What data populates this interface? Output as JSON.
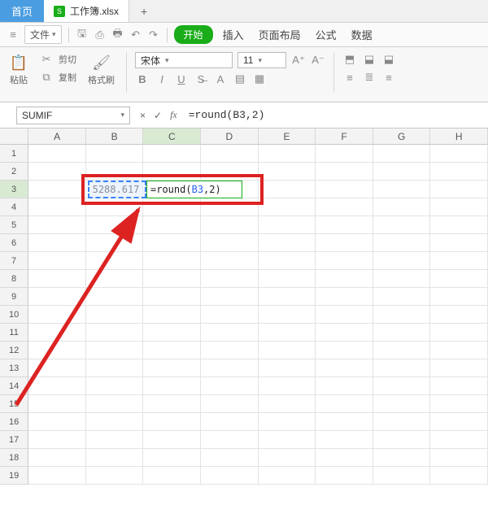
{
  "tabs": {
    "home": "首页",
    "file_icon_letter": "S",
    "filename": "工作簿.xlsx",
    "add": "+"
  },
  "quickbar": {
    "menu_label": "文件",
    "start": "开始",
    "ribbon_tabs": [
      "插入",
      "页面布局",
      "公式",
      "数据"
    ]
  },
  "ribbon": {
    "paste": "粘贴",
    "cut": "剪切",
    "copy": "复制",
    "format_painter": "格式刷",
    "font_name": "宋体",
    "font_size": "11"
  },
  "formula_bar": {
    "name_box": "SUMIF",
    "cancel": "×",
    "confirm": "✓",
    "fx": "fx",
    "formula": "=round(B3,2)"
  },
  "grid": {
    "columns": [
      "A",
      "B",
      "C",
      "D",
      "E",
      "F",
      "G",
      "H"
    ],
    "row_count": 19,
    "active_col_index": 2,
    "active_row": 3,
    "b3_value": "5288.617",
    "c3_editing_text": "=round(B3,2)",
    "c3_tokens": {
      "eq": "=",
      "fn": "round",
      "open": "(",
      "ref": "B3",
      "comma": ",",
      "num": "2",
      "close": ")"
    }
  }
}
